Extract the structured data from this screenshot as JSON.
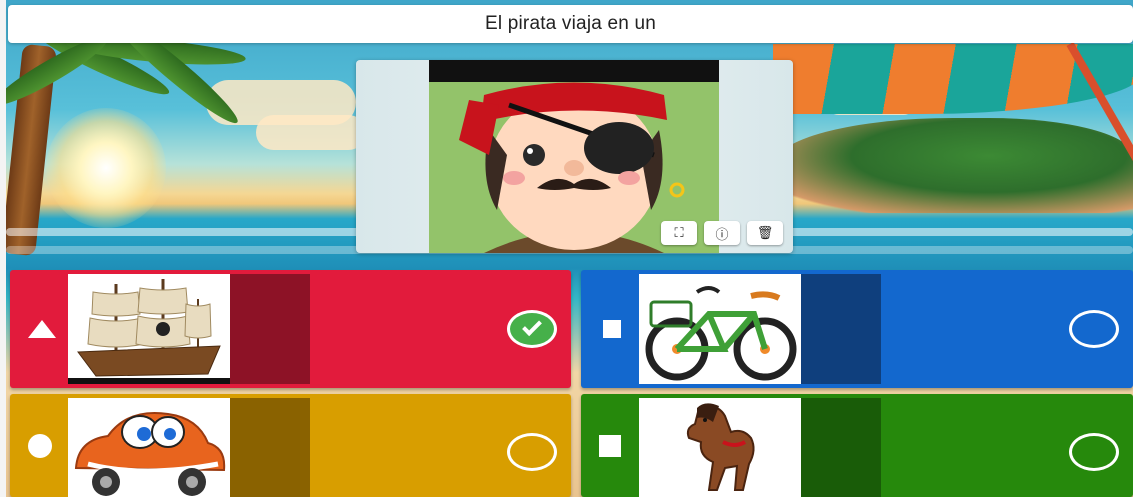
{
  "question": {
    "text": "El pirata viaja en un"
  },
  "media": {
    "image": "pirate-image",
    "toolbar": [
      {
        "icon": "crop-icon",
        "glyph": "⛶"
      },
      {
        "icon": "info-icon",
        "glyph": "ⓘ"
      },
      {
        "icon": "delete-icon",
        "glyph": "🗑"
      }
    ]
  },
  "answers": [
    {
      "shape": "triangle-icon",
      "image": "pirate-ship-image",
      "color": "#e21b3c",
      "state": "correct"
    },
    {
      "shape": "diamond-icon",
      "image": "bicycle-image",
      "color": "#1368ce",
      "state": "unselected"
    },
    {
      "shape": "circle-icon",
      "image": "car-image",
      "color": "#d89e00",
      "state": "unselected"
    },
    {
      "shape": "square-icon",
      "image": "horse-image",
      "color": "#26890c",
      "state": "unselected"
    }
  ]
}
